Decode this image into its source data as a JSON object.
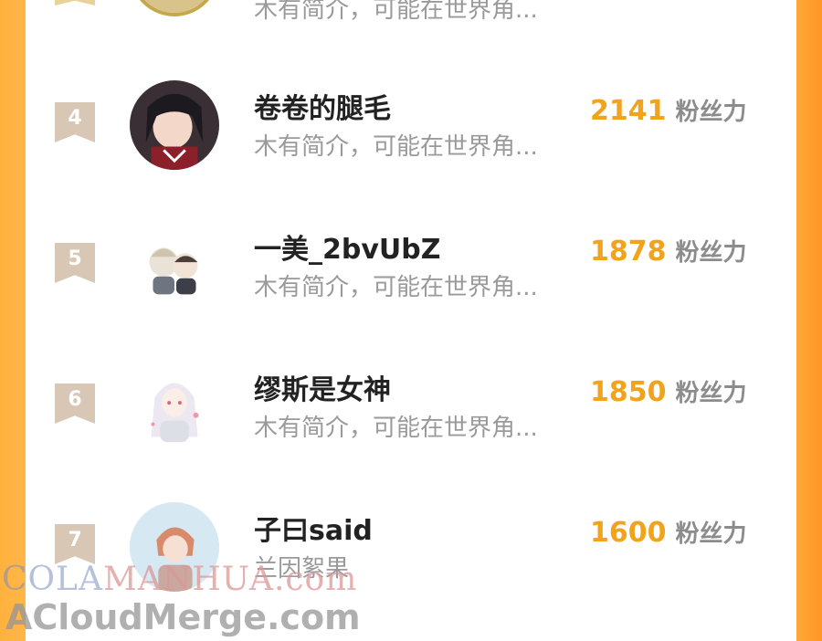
{
  "ranking": {
    "fans_unit": "粉丝力",
    "rows": [
      {
        "rank": "",
        "name": "",
        "intro": "木有简介，可能在世界角...",
        "fans": "",
        "avatar": "gold-frame-avatar"
      },
      {
        "rank": "4",
        "name": "卷卷的腿毛",
        "intro": "木有简介，可能在世界角...",
        "fans": "2141",
        "avatar": "dark-hair-girl-avatar"
      },
      {
        "rank": "5",
        "name": "一美_2bvUbZ",
        "intro": "木有简介，可能在世界角...",
        "fans": "1878",
        "avatar": "chibi-couple-avatar"
      },
      {
        "rank": "6",
        "name": "缪斯是女神",
        "intro": "木有简介，可能在世界角...",
        "fans": "1850",
        "avatar": "white-hair-girl-avatar"
      },
      {
        "rank": "7",
        "name": "子曰said",
        "intro": "兰因絮果",
        "fans": "1600",
        "avatar": "red-hair-boy-avatar"
      }
    ]
  },
  "watermarks": {
    "line1_part1": "COLA",
    "line1_part2": "MANHUA",
    "line1_part3": ".com",
    "line2": "ACloudMerge.com"
  },
  "colors": {
    "fans_number": "#f2a31c",
    "rank_badge": "#d9c7b5",
    "side_gradient": "#ffa838"
  }
}
